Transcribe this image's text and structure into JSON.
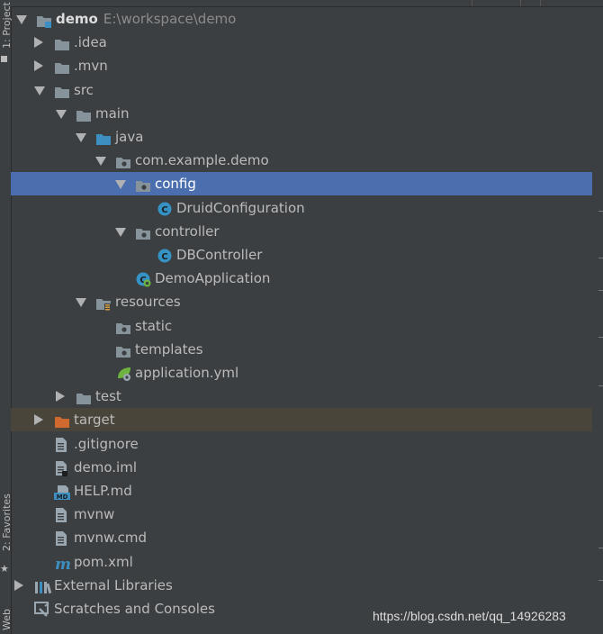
{
  "side_tabs": {
    "project": "1: Project",
    "favorites": "2: Favorites",
    "web": "Web"
  },
  "tree": [
    {
      "name": "demo",
      "path": "E:\\workspace\\demo",
      "arrow": "down",
      "icon": "module-folder-icon"
    },
    {
      "name": ".idea",
      "arrow": "right",
      "icon": "folder-icon"
    },
    {
      "name": ".mvn",
      "arrow": "right",
      "icon": "folder-icon"
    },
    {
      "name": "src",
      "arrow": "down",
      "icon": "folder-icon"
    },
    {
      "name": "main",
      "arrow": "down",
      "icon": "folder-icon"
    },
    {
      "name": "java",
      "arrow": "down",
      "icon": "source-folder-icon"
    },
    {
      "name": "com.example.demo",
      "arrow": "down",
      "icon": "package-icon"
    },
    {
      "name": "config",
      "arrow": "down",
      "icon": "package-icon",
      "selected": true
    },
    {
      "name": "DruidConfiguration",
      "icon": "class-icon"
    },
    {
      "name": "controller",
      "arrow": "down",
      "icon": "package-icon"
    },
    {
      "name": "DBController",
      "icon": "class-icon"
    },
    {
      "name": "DemoApplication",
      "icon": "spring-boot-class-icon"
    },
    {
      "name": "resources",
      "arrow": "down",
      "icon": "resources-folder-icon"
    },
    {
      "name": "static",
      "icon": "package-icon"
    },
    {
      "name": "templates",
      "icon": "package-icon"
    },
    {
      "name": "application.yml",
      "icon": "spring-config-icon"
    },
    {
      "name": "test",
      "arrow": "right",
      "icon": "folder-icon"
    },
    {
      "name": "target",
      "arrow": "right",
      "icon": "excluded-folder-icon",
      "excluded": true
    },
    {
      "name": ".gitignore",
      "icon": "text-file-icon"
    },
    {
      "name": "demo.iml",
      "icon": "iml-file-icon"
    },
    {
      "name": "HELP.md",
      "icon": "markdown-file-icon"
    },
    {
      "name": "mvnw",
      "icon": "text-file-icon"
    },
    {
      "name": "mvnw.cmd",
      "icon": "text-file-icon"
    },
    {
      "name": "pom.xml",
      "icon": "maven-icon"
    },
    {
      "name": "External Libraries",
      "arrow": "right",
      "icon": "libraries-icon"
    },
    {
      "name": "Scratches and Consoles",
      "icon": "scratches-icon"
    }
  ],
  "watermark": "https://blog.csdn.net/qq_14926283",
  "colors": {
    "background": "#3c3f41",
    "selection": "#4b6eaf",
    "excluded_row": "#49453a",
    "folder": "#87939a",
    "source_folder": "#3d8fc1",
    "excluded_folder": "#d0692f",
    "class_icon": "#3592c4"
  }
}
